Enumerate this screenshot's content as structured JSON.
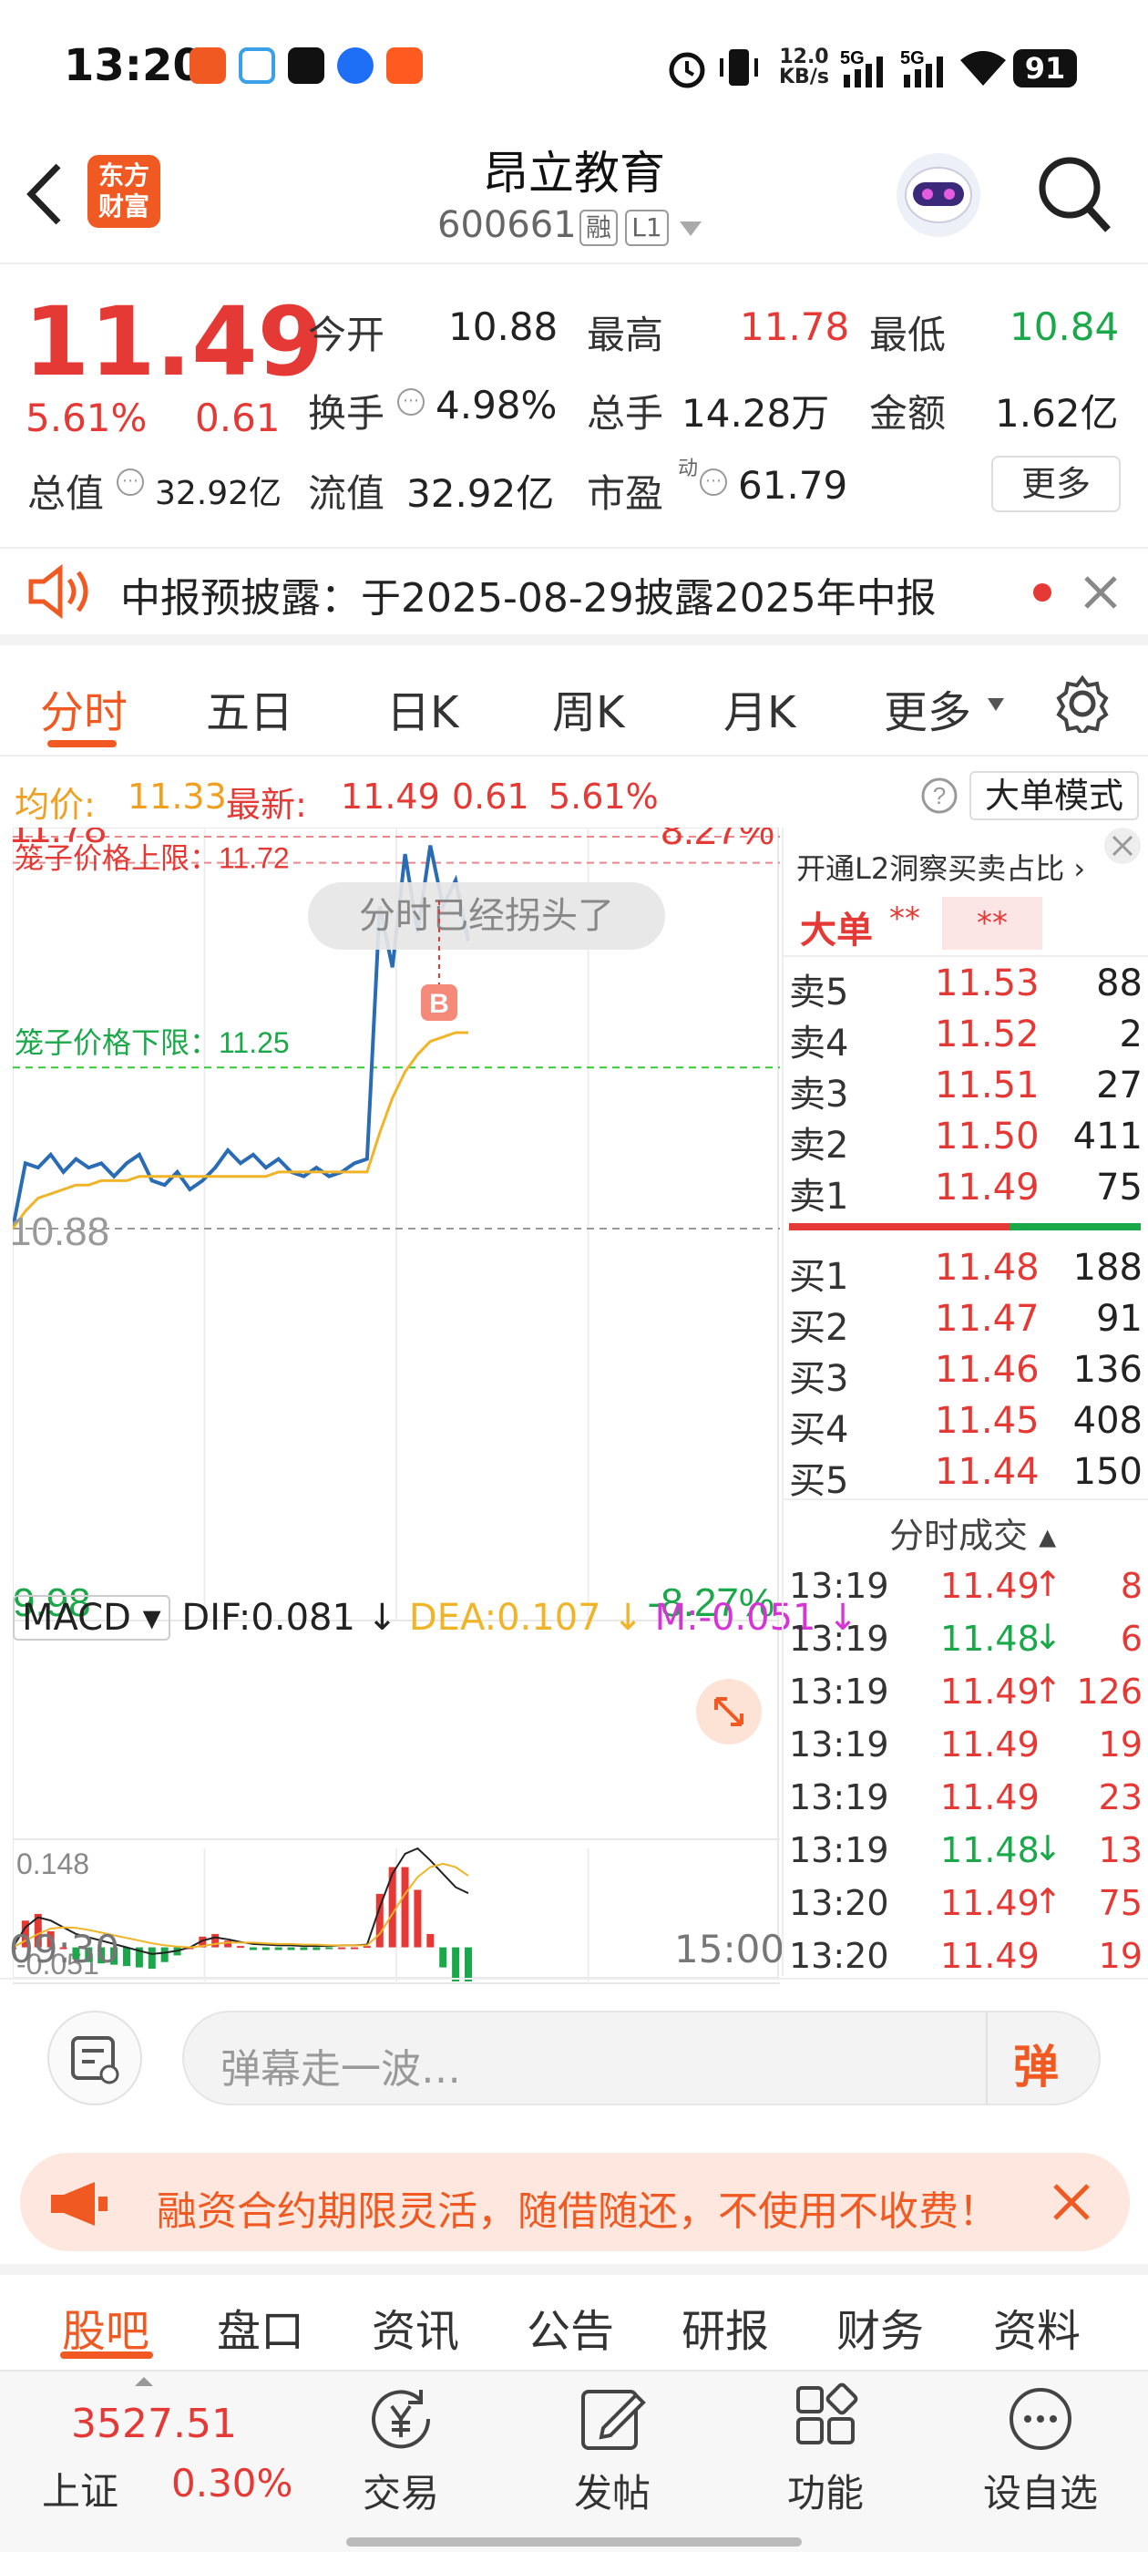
{
  "status_bar": {
    "time": "13:20",
    "speed_value": "12.0",
    "speed_unit": "KB/s",
    "signal1": "5G",
    "signal2": "5G",
    "battery": "91",
    "icons": [
      "alarm-icon",
      "vibrate-icon",
      "signal-icon",
      "wifi-icon"
    ]
  },
  "header": {
    "back_icon": "chevron-left-icon",
    "logo_line1": "东方",
    "logo_line2": "财富",
    "stock_name": "昂立教育",
    "stock_code": "600661",
    "badge_rong": "融",
    "badge_level": "L1",
    "search_icon": "search-icon"
  },
  "quote": {
    "price": "11.49",
    "change_pct": "5.61%",
    "change": "0.61",
    "open_label": "今开",
    "open": "10.88",
    "high_label": "最高",
    "high": "11.78",
    "low_label": "最低",
    "low": "10.84",
    "turnover_label": "换手",
    "turnover": "4.98%",
    "volume_label": "总手",
    "volume": "14.28万",
    "amount_label": "金额",
    "amount": "1.62亿",
    "mktcap_label": "总值",
    "mktcap": "32.92亿",
    "float_label": "流值",
    "float_cap": "32.92亿",
    "pe_label": "市盈",
    "pe_sup": "动",
    "pe": "61.79",
    "more_label": "更多"
  },
  "notice": {
    "text": "中报预披露：于2025-08-29披露2025年中报",
    "accent": "#f05a22"
  },
  "tabs": [
    "分时",
    "五日",
    "日K",
    "周K",
    "月K",
    "更多"
  ],
  "info_line": {
    "avg_label": "均价:",
    "avg": "11.33",
    "latest_label": "最新:",
    "latest": "11.49",
    "change": "0.61",
    "pct": "5.61%",
    "mode_label": "大单模式"
  },
  "chart_data": {
    "type": "line",
    "title": "",
    "y_top_label": "11.78",
    "y_pct_top": "8.27%",
    "y_base_label": "10.88",
    "y_bottom_label": "9.98",
    "y_pct_bottom": "-8.27%",
    "ylim": [
      9.98,
      11.78
    ],
    "upper_limit_label": "笼子价格上限：11.72",
    "upper_limit": 11.72,
    "lower_limit_label": "笼子价格下限：11.25",
    "lower_limit": 11.25,
    "base_price": 10.88,
    "tooltip": "分时已经拐头了",
    "buy_marker": "B",
    "x_start": "09:30",
    "x_end": "15:00",
    "series": [
      {
        "values": [
          10.88,
          11.03,
          11.02,
          11.05,
          11.01,
          11.04,
          11.02,
          11.03,
          11.0,
          11.03,
          11.05,
          10.99,
          10.98,
          11.01,
          10.97,
          10.99,
          11.02,
          11.06,
          11.03,
          11.05,
          11.02,
          11.04,
          11.01,
          11.0,
          11.02,
          11.0,
          11.01,
          11.03,
          11.04,
          11.62,
          11.48,
          11.74,
          11.56,
          11.76,
          11.62,
          11.68,
          11.54
        ]
      },
      {
        "values": [
          10.88,
          10.92,
          10.95,
          10.96,
          10.97,
          10.98,
          10.98,
          10.99,
          10.99,
          10.99,
          11.0,
          11.0,
          11.0,
          11.0,
          11.0,
          11.0,
          11.0,
          11.0,
          11.0,
          11.0,
          11.0,
          11.01,
          11.01,
          11.01,
          11.01,
          11.01,
          11.01,
          11.01,
          11.01,
          11.1,
          11.18,
          11.24,
          11.28,
          11.31,
          11.32,
          11.33,
          11.33
        ]
      }
    ],
    "macd": {
      "select_label": "MACD",
      "dif_label": "DIF:0.081",
      "dea_label": "DEA:0.107",
      "m_label": "M:-0.051",
      "ymax_label": "0.148",
      "ymin_label": "-0.051",
      "ylim": [
        -0.051,
        0.148
      ],
      "dif": [
        0.0,
        0.03,
        0.045,
        0.04,
        0.03,
        0.02,
        0.015,
        0.01,
        0.005,
        0.0,
        -0.005,
        -0.01,
        -0.008,
        -0.005,
        0.0,
        0.01,
        0.015,
        0.012,
        0.008,
        0.005,
        0.004,
        0.003,
        0.003,
        0.002,
        0.002,
        0.002,
        0.003,
        0.003,
        0.004,
        0.06,
        0.11,
        0.14,
        0.148,
        0.13,
        0.11,
        0.09,
        0.081
      ],
      "dea": [
        0.0,
        0.01,
        0.02,
        0.028,
        0.03,
        0.029,
        0.026,
        0.022,
        0.018,
        0.014,
        0.01,
        0.006,
        0.003,
        0.001,
        0.0,
        0.002,
        0.005,
        0.007,
        0.007,
        0.007,
        0.006,
        0.005,
        0.005,
        0.004,
        0.004,
        0.003,
        0.003,
        0.003,
        0.003,
        0.02,
        0.05,
        0.08,
        0.105,
        0.12,
        0.125,
        0.12,
        0.107
      ],
      "m": [
        0.0,
        0.04,
        0.05,
        0.024,
        0.0,
        -0.018,
        -0.022,
        -0.024,
        -0.026,
        -0.028,
        -0.03,
        -0.032,
        -0.022,
        -0.012,
        0.0,
        0.016,
        0.02,
        0.01,
        0.002,
        -0.004,
        -0.004,
        -0.004,
        -0.004,
        -0.004,
        -0.004,
        -0.002,
        0.0,
        0.0,
        0.002,
        0.08,
        0.12,
        0.12,
        0.086,
        0.02,
        -0.03,
        -0.051,
        -0.051
      ]
    }
  },
  "order_book": {
    "promo": "开通L2洞察买卖占比",
    "big_order_label": "大单",
    "big_order_value1": "**",
    "big_order_value2": "**",
    "asks": [
      {
        "label": "卖5",
        "price": "11.53",
        "vol": "88"
      },
      {
        "label": "卖4",
        "price": "11.52",
        "vol": "2"
      },
      {
        "label": "卖3",
        "price": "11.51",
        "vol": "27"
      },
      {
        "label": "卖2",
        "price": "11.50",
        "vol": "411"
      },
      {
        "label": "卖1",
        "price": "11.49",
        "vol": "75"
      }
    ],
    "ask_bid_ratio": 0.62,
    "bids": [
      {
        "label": "买1",
        "price": "11.48",
        "vol": "188"
      },
      {
        "label": "买2",
        "price": "11.47",
        "vol": "91"
      },
      {
        "label": "买3",
        "price": "11.46",
        "vol": "136"
      },
      {
        "label": "买4",
        "price": "11.45",
        "vol": "408"
      },
      {
        "label": "买5",
        "price": "11.44",
        "vol": "150"
      }
    ]
  },
  "ticks": {
    "title": "分时成交",
    "rows": [
      {
        "time": "13:19",
        "price": "11.49",
        "dir": "↑",
        "vol": "8",
        "color": "red"
      },
      {
        "time": "13:19",
        "price": "11.48",
        "dir": "↓",
        "vol": "6",
        "color": "green"
      },
      {
        "time": "13:19",
        "price": "11.49",
        "dir": "↑",
        "vol": "126",
        "color": "red"
      },
      {
        "time": "13:19",
        "price": "11.49",
        "dir": "",
        "vol": "19",
        "color": "red"
      },
      {
        "time": "13:19",
        "price": "11.49",
        "dir": "",
        "vol": "23",
        "color": "red"
      },
      {
        "time": "13:19",
        "price": "11.48",
        "dir": "↓",
        "vol": "13",
        "color": "green"
      },
      {
        "time": "13:20",
        "price": "11.49",
        "dir": "↑",
        "vol": "75",
        "color": "red"
      },
      {
        "time": "13:20",
        "price": "11.49",
        "dir": "",
        "vol": "19",
        "color": "red"
      }
    ]
  },
  "comment": {
    "placeholder": "弹幕走一波…",
    "danmu_label": "弹"
  },
  "ad": {
    "text": "融资合约期限灵活，随借随还，不使用不收费！"
  },
  "bottom_tabs": [
    "股吧",
    "盘口",
    "资讯",
    "公告",
    "研报",
    "财务",
    "资料"
  ],
  "bottom_nav": {
    "index_value": "3527.51",
    "index_name": "上证",
    "index_pct": "0.30%",
    "items": [
      {
        "label": "交易",
        "icon": "yen-exchange-icon"
      },
      {
        "label": "发帖",
        "icon": "edit-icon"
      },
      {
        "label": "功能",
        "icon": "grid-icon"
      },
      {
        "label": "设自选",
        "icon": "more-dots-icon"
      }
    ]
  },
  "colors": {
    "up": "#e53935",
    "down": "#1aa84a",
    "price_line": "#2a6bb5",
    "avg_line": "#f0b429",
    "brand": "#f05a22"
  }
}
